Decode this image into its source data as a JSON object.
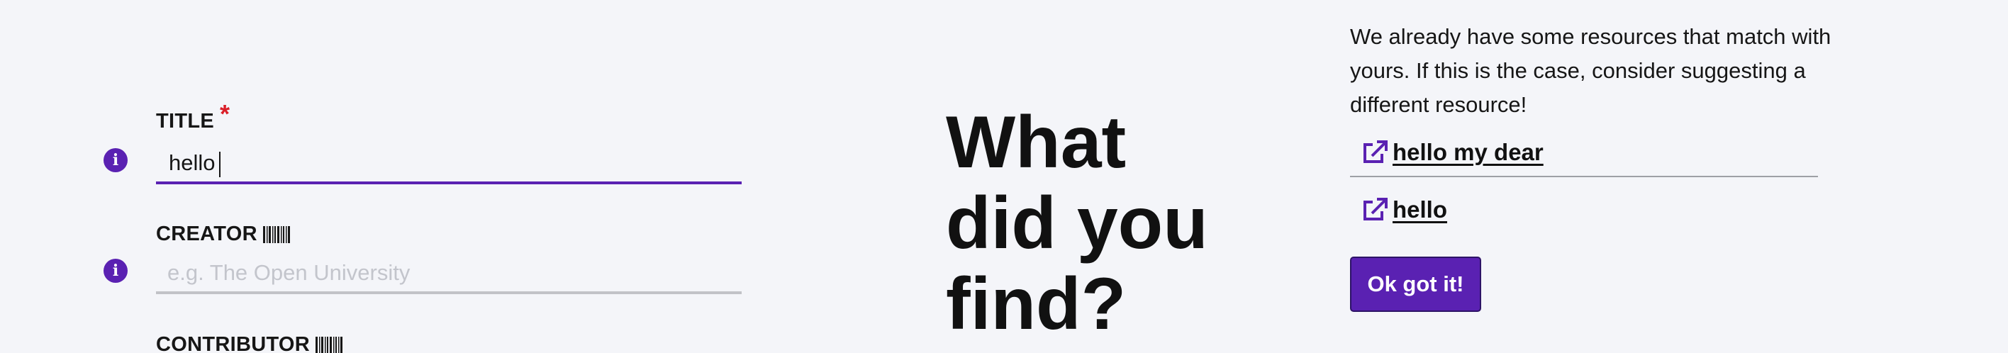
{
  "form": {
    "title": {
      "label": "TITLE",
      "required_marker": "*",
      "value": "hello"
    },
    "creator": {
      "label": "CREATOR",
      "placeholder": "e.g. The Open University",
      "value": ""
    },
    "contributor": {
      "label": "CONTRIBUTOR"
    }
  },
  "headline": "What did you find?",
  "matches": {
    "notice": "We already have some resources that match with yours. If this is the case, consider suggesting a different resource!",
    "items": [
      {
        "label": "hello my dear"
      },
      {
        "label": "hello"
      }
    ],
    "confirm_label": "Ok got it!"
  },
  "colors": {
    "accent": "#5a21b2",
    "required": "#da1e28",
    "background": "#f4f5f9",
    "input_border": "#c1c2c7"
  },
  "icons": {
    "field_info": "info-icon",
    "field_type": "barcode-icon",
    "match_link": "external-link-icon"
  }
}
